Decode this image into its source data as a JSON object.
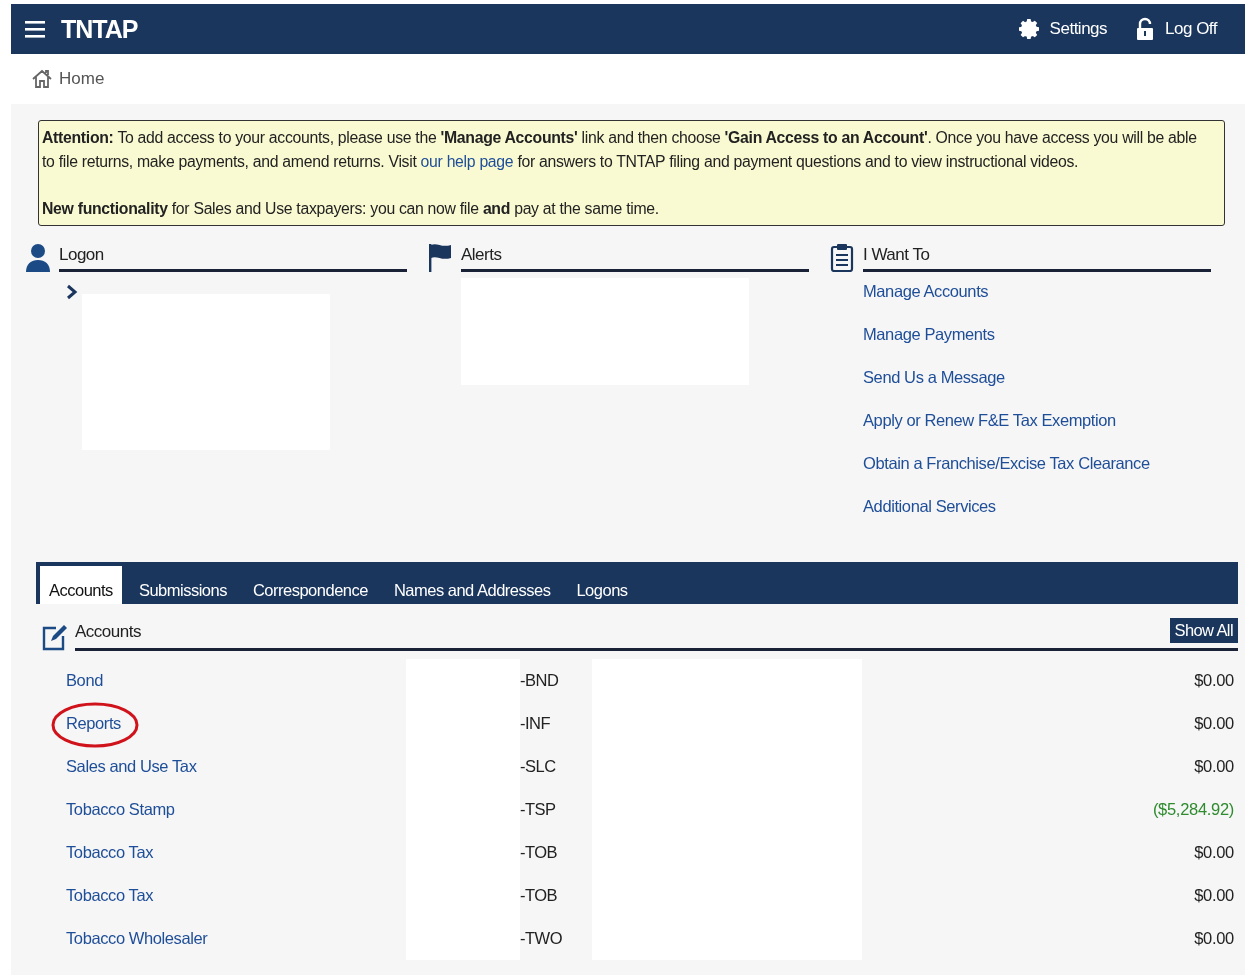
{
  "header": {
    "title": "TNTAP",
    "actions": [
      {
        "kind": "settings",
        "label": "Settings"
      },
      {
        "kind": "logoff",
        "label": "Log Off"
      }
    ]
  },
  "breadcrumb": {
    "label": "Home"
  },
  "notice": {
    "paragraphs": [
      {
        "before": "**Attention:** To add access to your accounts, please use the **'Manage Accounts'** link and then choose **'Gain Access to an Account'**. Once you have access you will be able to file returns, make payments, and amend returns. Visit",
        "link": "our help page",
        "after": "for answers to TNTAP filing and payment questions and to view instructional videos."
      },
      {
        "before": "**New functionality** for Sales and Use taxpayers: you can now file **and** pay at the same time."
      }
    ]
  },
  "panels": [
    {
      "kind": "logon",
      "title": "Logon"
    },
    {
      "kind": "alerts",
      "title": "Alerts"
    },
    {
      "kind": "links",
      "title": "I Want To",
      "links": [
        "Manage Accounts",
        "Manage Payments",
        "Send Us a Message",
        "Apply or Renew F&E Tax Exemption",
        "Obtain a Franchise/Excise Tax Clearance",
        "Additional Services"
      ]
    }
  ],
  "tabs": [
    {
      "label": "Accounts",
      "selected": true
    },
    {
      "label": "Submissions",
      "selected": false
    },
    {
      "label": "Correspondence",
      "selected": false
    },
    {
      "label": "Names and Addresses",
      "selected": false
    },
    {
      "label": "Logons",
      "selected": false
    }
  ],
  "accounts": {
    "title": "Accounts",
    "show_all": "Show All",
    "rows": [
      {
        "name": "Bond",
        "suffix": "-BND",
        "amount": "$0.00",
        "color": "#222222",
        "circled": false
      },
      {
        "name": "Reports",
        "suffix": "-INF",
        "amount": "$0.00",
        "color": "#222222",
        "circled": true
      },
      {
        "name": "Sales and Use Tax",
        "suffix": "-SLC",
        "amount": "$0.00",
        "color": "#222222",
        "circled": false
      },
      {
        "name": "Tobacco Stamp",
        "suffix": "-TSP",
        "amount": "($5,284.92)",
        "color": "#2e8b2e",
        "circled": false
      },
      {
        "name": "Tobacco Tax",
        "suffix": "-TOB",
        "amount": "$0.00",
        "color": "#222222",
        "circled": false
      },
      {
        "name": "Tobacco Tax",
        "suffix": "-TOB",
        "amount": "$0.00",
        "color": "#222222",
        "circled": false
      },
      {
        "name": "Tobacco Wholesaler",
        "suffix": "-TWO",
        "amount": "$0.00",
        "color": "#222222",
        "circled": false
      }
    ]
  }
}
